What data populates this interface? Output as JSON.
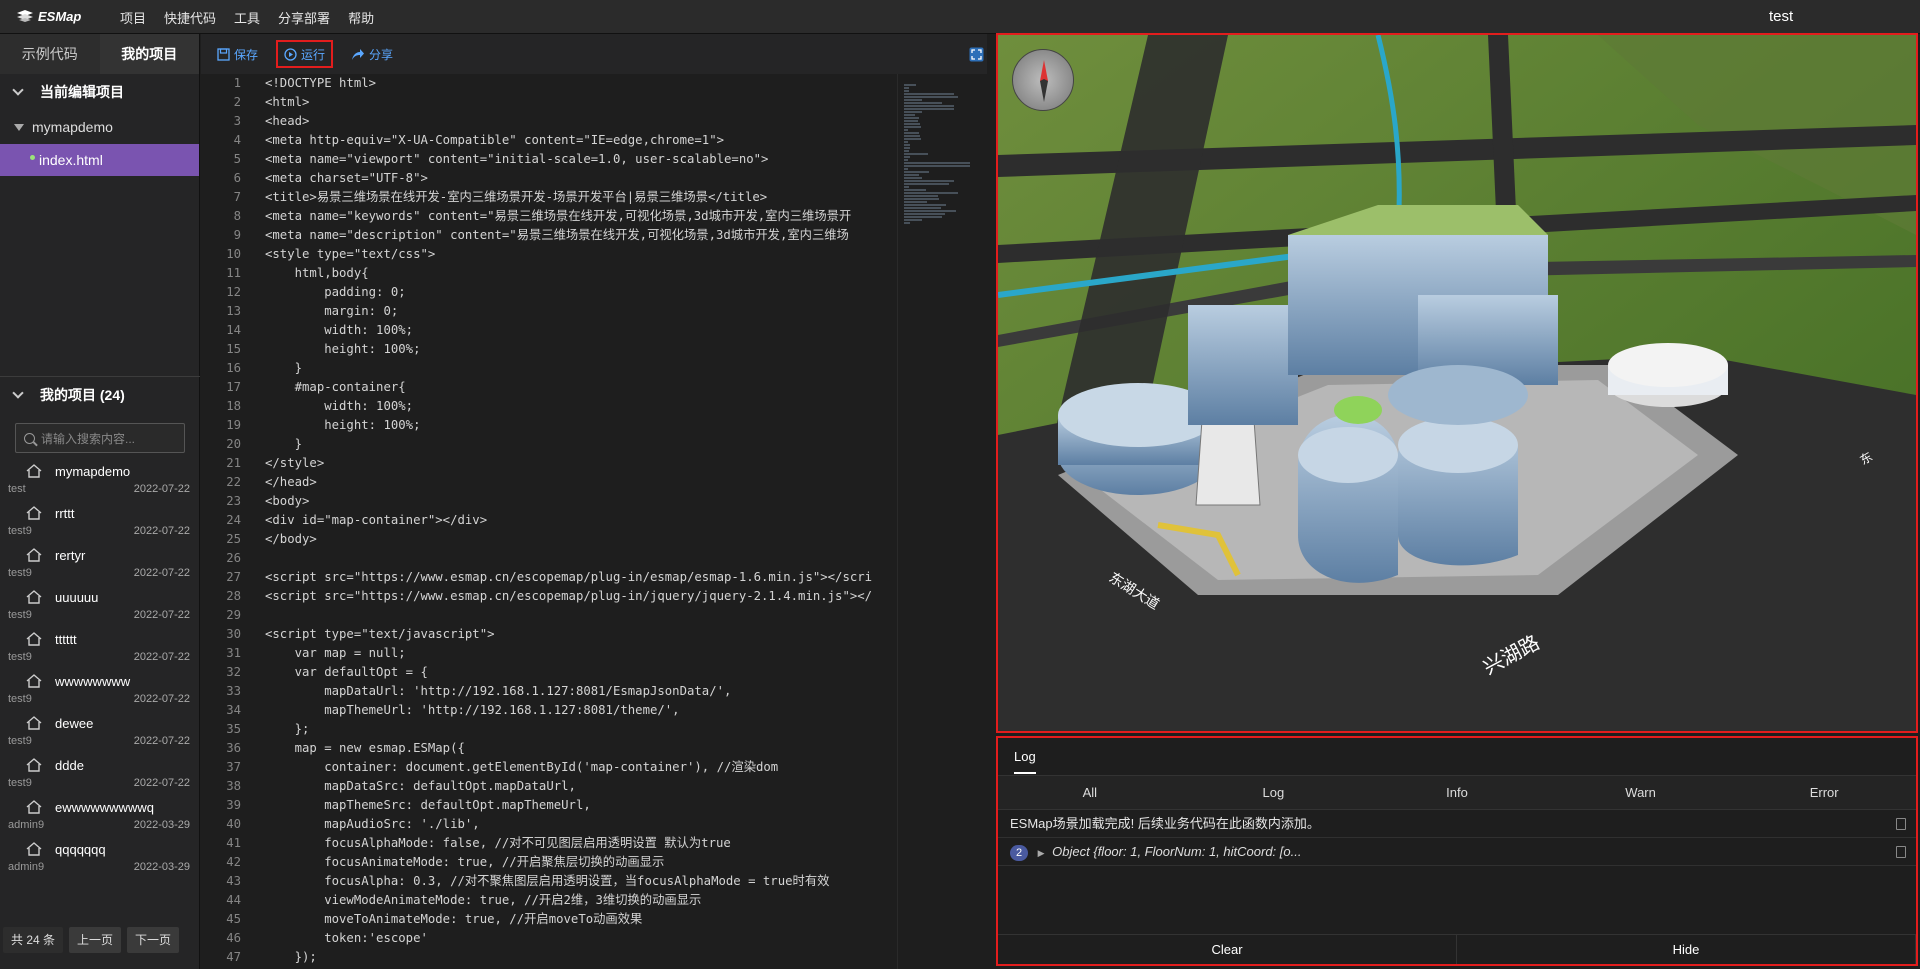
{
  "app": {
    "name": "ESMap",
    "project_title": "test"
  },
  "menu": [
    "项目",
    "快捷代码",
    "工具",
    "分享部署",
    "帮助"
  ],
  "sidebar": {
    "tabs": [
      "示例代码",
      "我的项目"
    ],
    "current_section": "当前编辑项目",
    "tree": {
      "folder": "mymapdemo",
      "file": "index.html"
    },
    "my_projects_label": "我的项目 (24)",
    "search_placeholder": "请输入搜索内容...",
    "projects": [
      {
        "name": "mymapdemo",
        "owner": "test",
        "date": "2022-07-22"
      },
      {
        "name": "rrttt",
        "owner": "test9",
        "date": "2022-07-22"
      },
      {
        "name": "rertyr",
        "owner": "test9",
        "date": "2022-07-22"
      },
      {
        "name": "uuuuuu",
        "owner": "test9",
        "date": "2022-07-22"
      },
      {
        "name": "tttttt",
        "owner": "test9",
        "date": "2022-07-22"
      },
      {
        "name": "wwwwwwww",
        "owner": "test9",
        "date": "2022-07-22"
      },
      {
        "name": "dewee",
        "owner": "test9",
        "date": "2022-07-22"
      },
      {
        "name": "ddde",
        "owner": "test9",
        "date": "2022-07-22"
      },
      {
        "name": "ewwwwwwwwwq",
        "owner": "admin9",
        "date": "2022-03-29"
      },
      {
        "name": "qqqqqqq",
        "owner": "admin9",
        "date": "2022-03-29"
      }
    ],
    "pager": {
      "count": "共 24 条",
      "prev": "上一页",
      "next": "下一页"
    }
  },
  "toolbar": {
    "save": "保存",
    "run": "运行",
    "share": "分享"
  },
  "log": {
    "tab": "Log",
    "filters": [
      "All",
      "Log",
      "Info",
      "Warn",
      "Error"
    ],
    "entries": [
      {
        "text": "ESMap场景加载完成! 后续业务代码在此函数内添加。"
      },
      {
        "count": "2",
        "text": "Object {floor: 1, FloorNum: 1, hitCoord: [o..."
      }
    ],
    "clear": "Clear",
    "hide": "Hide"
  },
  "map_labels": [
    "东湖大道",
    "兴湖路",
    "东"
  ],
  "code_lines": [
    "<!DOCTYPE html>",
    "<html>",
    "<head>",
    "<meta http-equiv=\"X-UA-Compatible\" content=\"IE=edge,chrome=1\">",
    "<meta name=\"viewport\" content=\"initial-scale=1.0, user-scalable=no\">",
    "<meta charset=\"UTF-8\">",
    "<title>易景三维场景在线开发-室内三维场景开发-场景开发平台|易景三维场景</title>",
    "<meta name=\"keywords\" content=\"易景三维场景在线开发,可视化场景,3d城市开发,室内三维场景开",
    "<meta name=\"description\" content=\"易景三维场景在线开发,可视化场景,3d城市开发,室内三维场",
    "<style type=\"text/css\">",
    "    html,body{",
    "        padding: 0;",
    "        margin: 0;",
    "        width: 100%;",
    "        height: 100%;",
    "    }",
    "    #map-container{",
    "        width: 100%;",
    "        height: 100%;",
    "    }",
    "</style>",
    "</head>",
    "<body>",
    "<div id=\"map-container\"></div>",
    "</body>",
    "",
    "<script src=\"https://www.esmap.cn/escopemap/plug-in/esmap/esmap-1.6.min.js\"></scri",
    "<script src=\"https://www.esmap.cn/escopemap/plug-in/jquery/jquery-2.1.4.min.js\"></",
    "",
    "<script type=\"text/javascript\">",
    "    var map = null;",
    "    var defaultOpt = {",
    "        mapDataUrl: 'http://192.168.1.127:8081/EsmapJsonData/',",
    "        mapThemeUrl: 'http://192.168.1.127:8081/theme/',",
    "    };",
    "    map = new esmap.ESMap({",
    "        container: document.getElementById('map-container'), //渲染dom",
    "        mapDataSrc: defaultOpt.mapDataUrl,",
    "        mapThemeSrc: defaultOpt.mapThemeUrl,",
    "        mapAudioSrc: './lib',",
    "        focusAlphaMode: false, //对不可见图层启用透明设置 默认为true",
    "        focusAnimateMode: true, //开启聚焦层切换的动画显示",
    "        focusAlpha: 0.3, //对不聚焦图层启用透明设置，当focusAlphaMode = true时有效",
    "        viewModeAnimateMode: true, //开启2维，3维切换的动画显示",
    "        moveToAnimateMode: true, //开启moveTo动画效果",
    "        token:'escope'",
    "    });"
  ]
}
